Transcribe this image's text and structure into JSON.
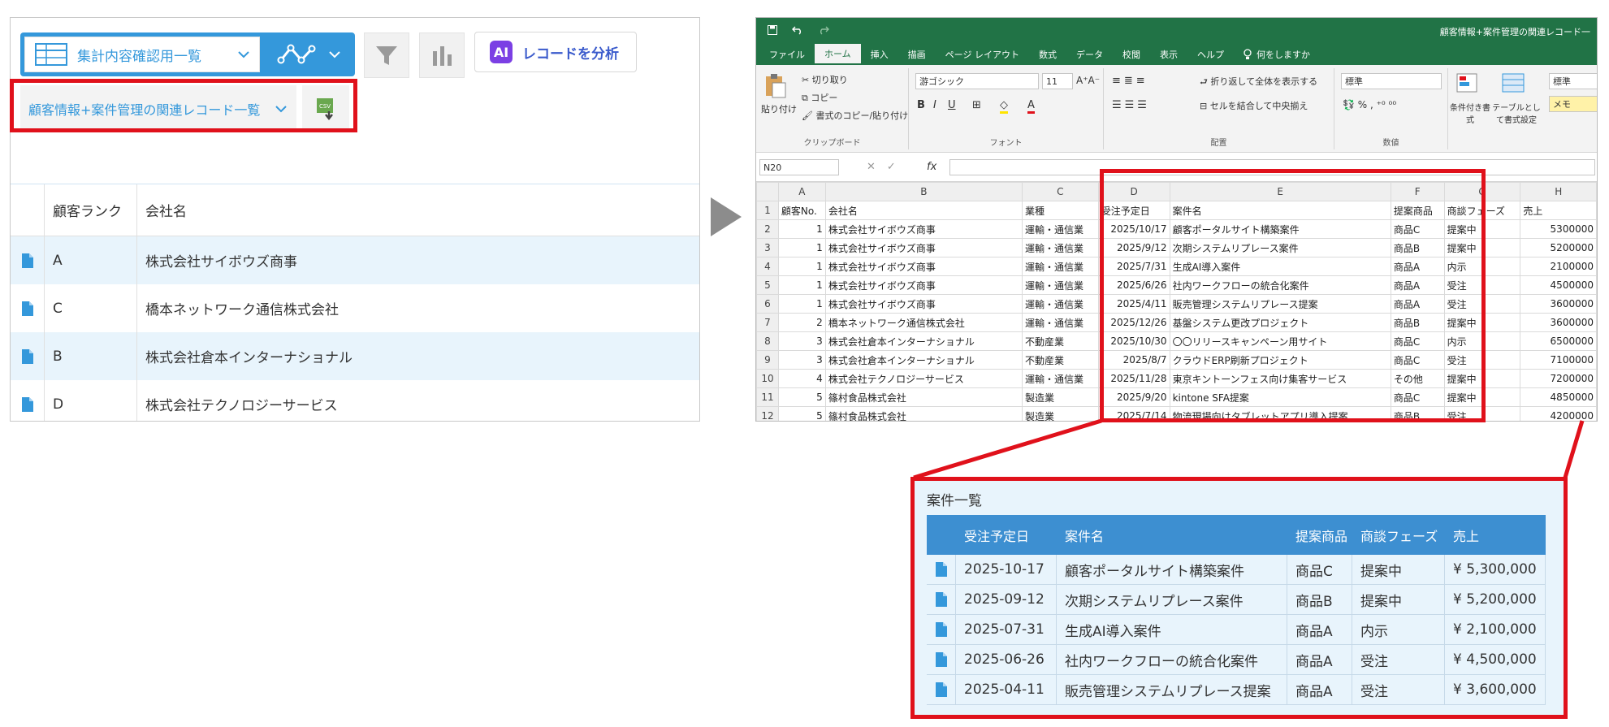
{
  "kintone": {
    "view_selector": "集計内容確認用一覧",
    "ai_button": "レコードを分析",
    "ai_badge": "AI",
    "related_selector": "顧客情報+案件管理の関連レコード一覧",
    "csv_label": "CSV",
    "table": {
      "headers": [
        "顧客ランク",
        "会社名"
      ],
      "rows": [
        {
          "rank": "A",
          "company": "株式会社サイボウズ商事"
        },
        {
          "rank": "C",
          "company": "橋本ネットワーク通信株式会社"
        },
        {
          "rank": "B",
          "company": "株式会社倉本インターナショナル"
        },
        {
          "rank": "D",
          "company": "株式会社テクノロジーサービス"
        }
      ]
    }
  },
  "excel": {
    "title": "顧客情報+案件管理の関連レコード一",
    "tabs": [
      "ファイル",
      "ホーム",
      "挿入",
      "描画",
      "ページ レイアウト",
      "数式",
      "データ",
      "校閲",
      "表示",
      "ヘルプ",
      "何をしますか"
    ],
    "ribbon": {
      "paste": "貼り付け",
      "cut": "切り取り",
      "copy": "コピー",
      "format_painter": "書式のコピー/貼り付け",
      "clipboard": "クリップボード",
      "font_name": "游ゴシック",
      "font_size": "11",
      "font": "フォント",
      "wrap": "折り返して全体を表示する",
      "merge": "セルを結合して中央揃え",
      "alignment": "配置",
      "number_format": "標準",
      "number": "数値",
      "conditional": "条件付き書式",
      "table_format": "テーブルとして書式設定",
      "style_std": "標準",
      "style_memo": "メモ"
    },
    "name_box": "N20",
    "columns": [
      "A",
      "B",
      "C",
      "D",
      "E",
      "F",
      "G",
      "H"
    ],
    "rows": [
      [
        "1",
        "顧客No.",
        "会社名",
        "業種",
        "受注予定日",
        "案件名",
        "提案商品",
        "商談フェーズ",
        "売上"
      ],
      [
        "2",
        "1",
        "株式会社サイボウズ商事",
        "運輸・通信業",
        "2025/10/17",
        "顧客ポータルサイト構築案件",
        "商品C",
        "提案中",
        "5300000"
      ],
      [
        "3",
        "1",
        "株式会社サイボウズ商事",
        "運輸・通信業",
        "2025/9/12",
        "次期システムリプレース案件",
        "商品B",
        "提案中",
        "5200000"
      ],
      [
        "4",
        "1",
        "株式会社サイボウズ商事",
        "運輸・通信業",
        "2025/7/31",
        "生成AI導入案件",
        "商品A",
        "内示",
        "2100000"
      ],
      [
        "5",
        "1",
        "株式会社サイボウズ商事",
        "運輸・通信業",
        "2025/6/26",
        "社内ワークフローの統合化案件",
        "商品A",
        "受注",
        "4500000"
      ],
      [
        "6",
        "1",
        "株式会社サイボウズ商事",
        "運輸・通信業",
        "2025/4/11",
        "販売管理システムリプレース提案",
        "商品A",
        "受注",
        "3600000"
      ],
      [
        "7",
        "2",
        "橋本ネットワーク通信株式会社",
        "運輸・通信業",
        "2025/12/26",
        "基盤システム更改プロジェクト",
        "商品B",
        "提案中",
        "3600000"
      ],
      [
        "8",
        "3",
        "株式会社倉本インターナショナル",
        "不動産業",
        "2025/10/30",
        "〇〇リリースキャンペーン用サイト",
        "商品C",
        "内示",
        "6500000"
      ],
      [
        "9",
        "3",
        "株式会社倉本インターナショナル",
        "不動産業",
        "2025/8/7",
        "クラウドERP刷新プロジェクト",
        "商品C",
        "受注",
        "7100000"
      ],
      [
        "10",
        "4",
        "株式会社テクノロジーサービス",
        "運輸・通信業",
        "2025/11/28",
        "東京キントーンフェス向け集客サービス",
        "その他",
        "提案中",
        "7200000"
      ],
      [
        "11",
        "5",
        "篠村食品株式会社",
        "製造業",
        "2025/9/20",
        "kintone SFA提案",
        "商品C",
        "提案中",
        "4850000"
      ],
      [
        "12",
        "5",
        "篠村食品株式会社",
        "製造業",
        "2025/7/14",
        "物流現場向けタブレットアプリ導入提案",
        "商品B",
        "受注",
        "4200000"
      ]
    ]
  },
  "detail": {
    "title": "案件一覧",
    "headers": [
      "受注予定日",
      "案件名",
      "提案商品",
      "商談フェーズ",
      "売上"
    ],
    "rows": [
      [
        "2025-10-17",
        "顧客ポータルサイト構築案件",
        "商品C",
        "提案中",
        "¥ 5,300,000"
      ],
      [
        "2025-09-12",
        "次期システムリプレース案件",
        "商品B",
        "提案中",
        "¥ 5,200,000"
      ],
      [
        "2025-07-31",
        "生成AI導入案件",
        "商品A",
        "内示",
        "¥ 2,100,000"
      ],
      [
        "2025-06-26",
        "社内ワークフローの統合化案件",
        "商品A",
        "受注",
        "¥ 4,500,000"
      ],
      [
        "2025-04-11",
        "販売管理システムリプレース提案",
        "商品A",
        "受注",
        "¥ 3,600,000"
      ]
    ]
  },
  "colors": {
    "kintone_blue": "#3498db",
    "excel_green": "#217346",
    "highlight_red": "#e0111b",
    "row_highlight": "#e8f4fc"
  }
}
